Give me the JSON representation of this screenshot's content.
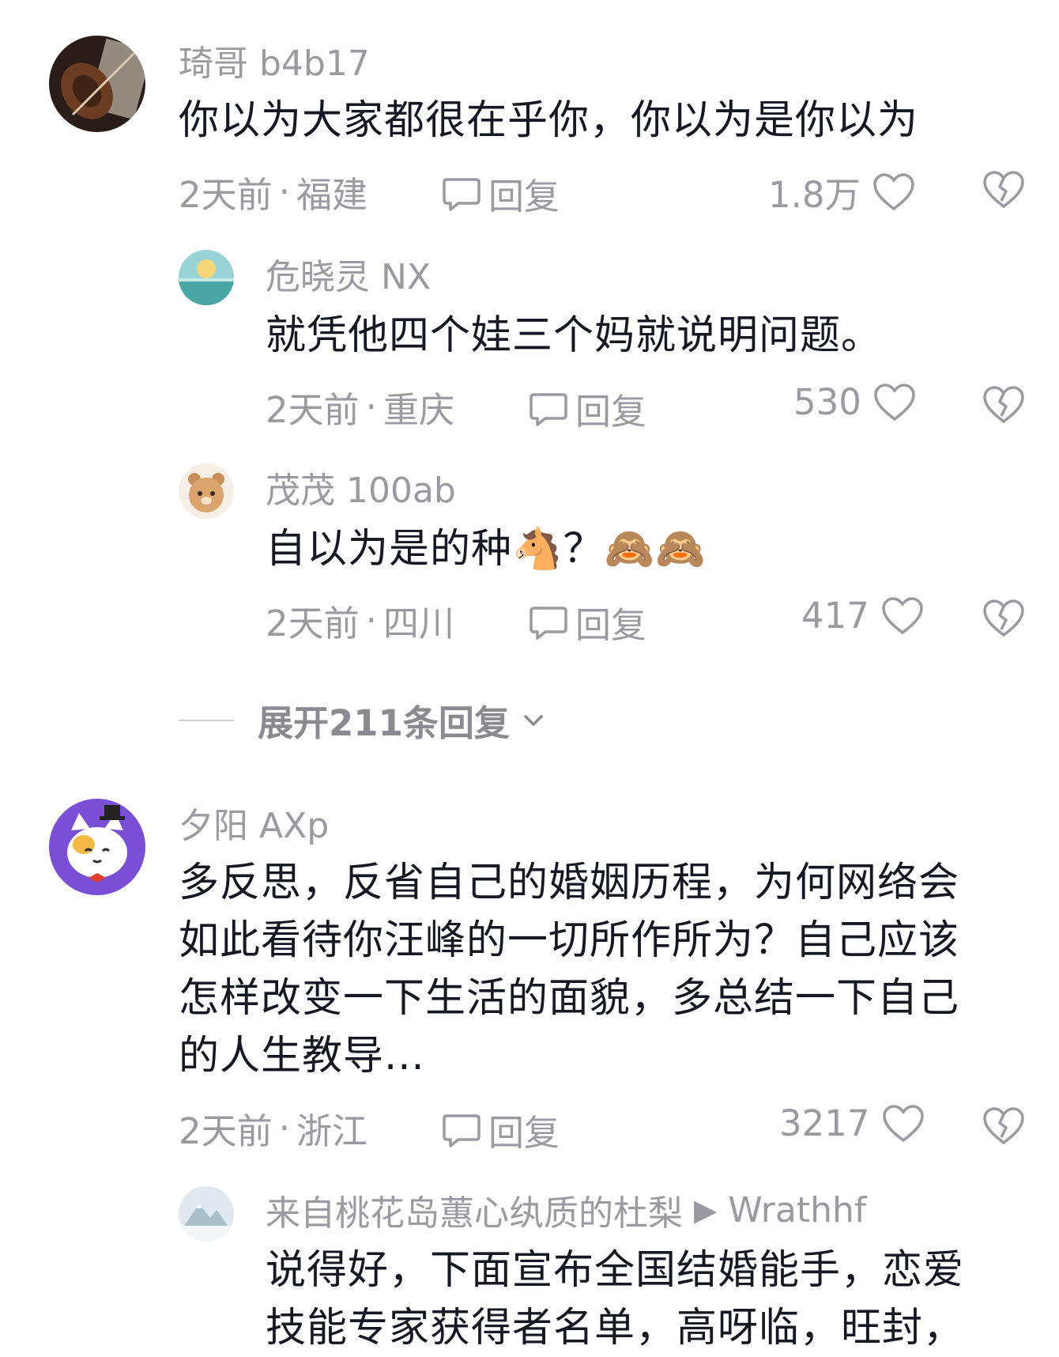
{
  "comments": [
    {
      "username": "琦哥 b4b17",
      "text": "你以为大家都很在乎你，你以为是你以为",
      "time": "2天前",
      "location": "福建",
      "reply_label": "回复",
      "likes": "1.8万",
      "avatar_icon": "violin-avatar"
    },
    {
      "username": "危晓灵 NX",
      "text": "就凭他四个娃三个妈就说明问题。",
      "time": "2天前",
      "location": "重庆",
      "reply_label": "回复",
      "likes": "530",
      "avatar_icon": "sea-sun-avatar"
    },
    {
      "username": "茂茂 100ab",
      "text": "自以为是的种",
      "emoji_1": "🐴",
      "text_tail": "？",
      "emoji_2": "🙈",
      "emoji_3": "🙈",
      "time": "2天前",
      "location": "四川",
      "reply_label": "回复",
      "likes": "417",
      "avatar_icon": "bear-avatar"
    },
    {
      "username": "夕阳 AXp",
      "text_lines": [
        "多反思，反省自己的婚姻历程，为何网络会",
        "如此看待你汪峰的一切所作所为？自己应该",
        "怎样改变一下生活的面貌，多总结一下自己",
        "的人生教导..."
      ],
      "time": "2天前",
      "location": "浙江",
      "reply_label": "回复",
      "likes": "3217",
      "avatar_icon": "cat-avatar"
    },
    {
      "username": "来自桃花岛蕙心纨质的杜梨",
      "reply_to": "Wrathhf",
      "text_lines": [
        "说得好，下面宣布全国结婚能手，恋爱",
        "技能专家获得者名单，高呀临，旺封，"
      ],
      "avatar_icon": "snow-mountain-avatar"
    }
  ],
  "expand_replies": "展开211条回复",
  "separator": "·",
  "colors": {
    "secondary_text": "#9a9aa0",
    "primary_text": "#161823"
  }
}
